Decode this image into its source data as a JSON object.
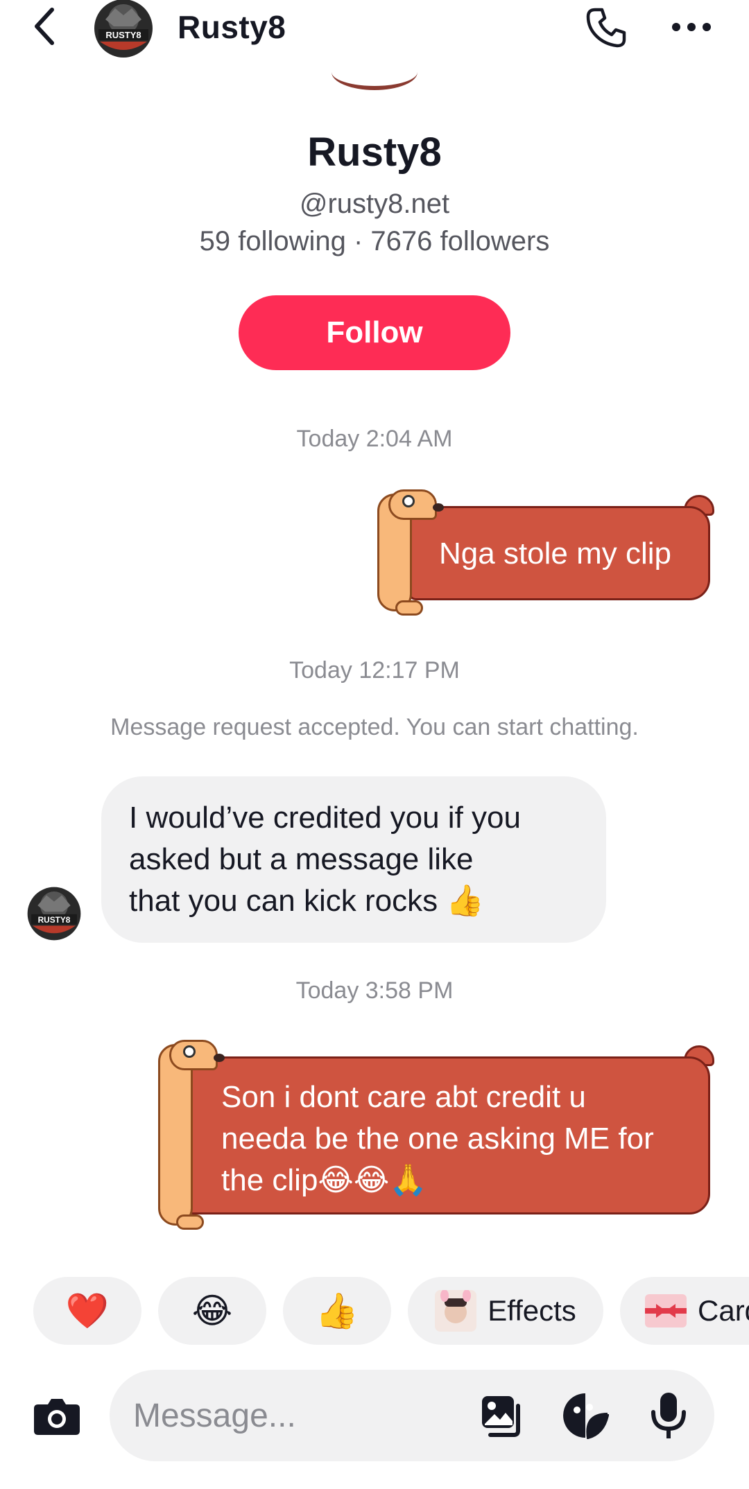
{
  "header": {
    "title": "Rusty8",
    "avatar_text": "RUSTY8",
    "icons": [
      "chevron-left-icon",
      "phone-icon",
      "more-horizontal-icon"
    ]
  },
  "profile": {
    "name": "Rusty8",
    "handle": "@rusty8.net",
    "stats": "59 following · 7676 followers",
    "follow_label": "Follow"
  },
  "conversation": [
    {
      "type": "timestamp",
      "text": "Today 2:04 AM"
    },
    {
      "type": "sent_sticker",
      "text": "Nga stole my clip"
    },
    {
      "type": "timestamp",
      "text": "Today 12:17 PM"
    },
    {
      "type": "system",
      "text": "Message request accepted. You can start chatting."
    },
    {
      "type": "received",
      "lines": [
        "I would’ve credited you if you",
        "asked but a message like",
        "that you can kick rocks 👍"
      ]
    },
    {
      "type": "timestamp",
      "text": "Today 3:58 PM"
    },
    {
      "type": "sent_sticker",
      "lines": [
        "Son i dont care abt credit u",
        "needa be the one asking ME for",
        "the clip😂😂🙏"
      ]
    }
  ],
  "quick_reactions": [
    {
      "emoji": "❤️",
      "label": ""
    },
    {
      "emoji": "😂",
      "label": ""
    },
    {
      "emoji": "👍",
      "label": ""
    },
    {
      "emoji": "",
      "label": "Effects"
    },
    {
      "emoji": "",
      "label": "Card"
    }
  ],
  "composer": {
    "placeholder": "Message...",
    "icons": [
      "camera-icon",
      "gallery-icon",
      "sticker-icon",
      "microphone-icon"
    ]
  },
  "colors": {
    "follow": "#fe2c55",
    "sticker_bubble": "#cf5440",
    "received_bubble": "#f1f1f2",
    "timestamp": "#8a8b91"
  }
}
